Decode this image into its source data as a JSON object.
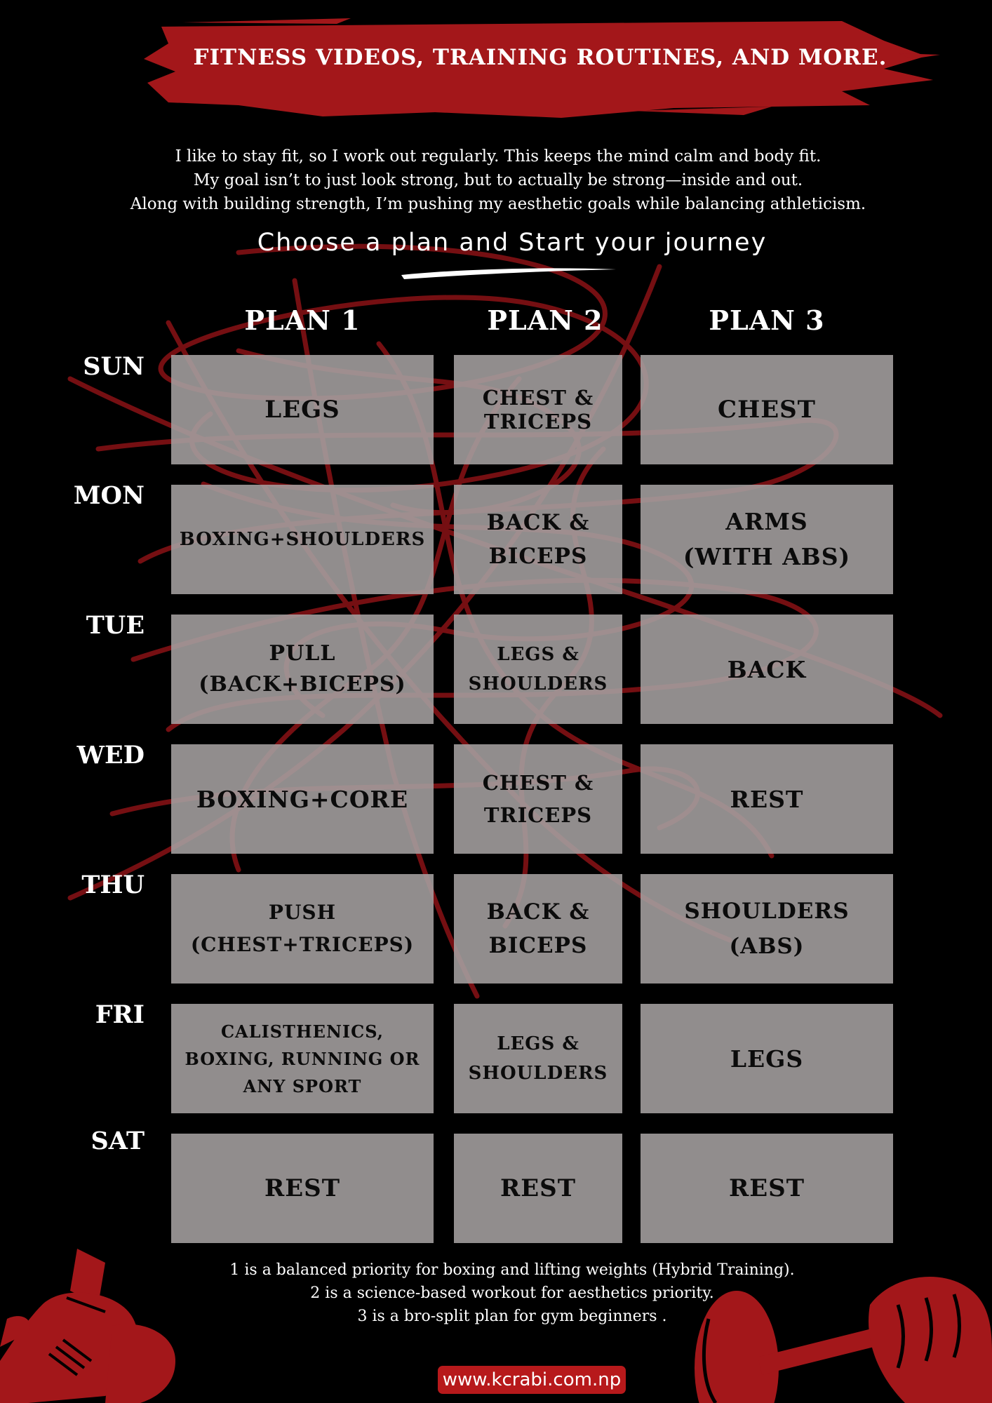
{
  "banner": {
    "title": "FITNESS VIDEOS, TRAINING ROUTINES, AND MORE.",
    "color": "#a3171a"
  },
  "intro": {
    "lines": [
      "I like to stay fit, so I work out regularly. This keeps the mind calm and body fit.",
      "My goal isn’t to just look strong, but to actually be strong—inside and out.",
      "Along with building strength, I’m pushing my aesthetic goals while balancing athleticism."
    ]
  },
  "cta": "Choose a plan and Start your journey",
  "plans": [
    "PLAN 1",
    "PLAN 2",
    "PLAN 3"
  ],
  "schedule": [
    {
      "day": "SUN",
      "plan1": "LEGS",
      "plan2": "CHEST &\nTRICEPS",
      "plan3": "CHEST"
    },
    {
      "day": "MON",
      "plan1": "BOXING+SHOULDERS",
      "plan2": "BACK &\nBICEPS",
      "plan3": "ARMS\n(WITH ABS)"
    },
    {
      "day": "TUE",
      "plan1": "PULL\n(BACK+BICEPS)",
      "plan2": "LEGS &\nSHOULDERS",
      "plan3": "BACK"
    },
    {
      "day": "WED",
      "plan1": "BOXING+CORE",
      "plan2": "CHEST &\nTRICEPS",
      "plan3": "REST"
    },
    {
      "day": "THU",
      "plan1": "PUSH\n(CHEST+TRICEPS)",
      "plan2": "BACK &\nBICEPS",
      "plan3": "SHOULDERS\n(ABS)"
    },
    {
      "day": "FRI",
      "plan1": "CALISTHENICS,\nBOXING, RUNNING OR\nANY SPORT",
      "plan2": "LEGS &\nSHOULDERS",
      "plan3": "LEGS"
    },
    {
      "day": "SAT",
      "plan1": "REST",
      "plan2": "REST",
      "plan3": "REST"
    }
  ],
  "notes": [
    "1 is a balanced priority for boxing and lifting weights (Hybrid Training).",
    "2 is a science-based workout for aesthetics priority.",
    "3 is a bro-split plan for gym beginners ."
  ],
  "url": "www.kcrabi.com.np",
  "icons": {
    "left": "boxing-glove-icon",
    "right": "fist-dumbbell-icon"
  },
  "colors": {
    "accent": "#b7191b",
    "cell": "#a5a0a0",
    "background": "#000000"
  }
}
